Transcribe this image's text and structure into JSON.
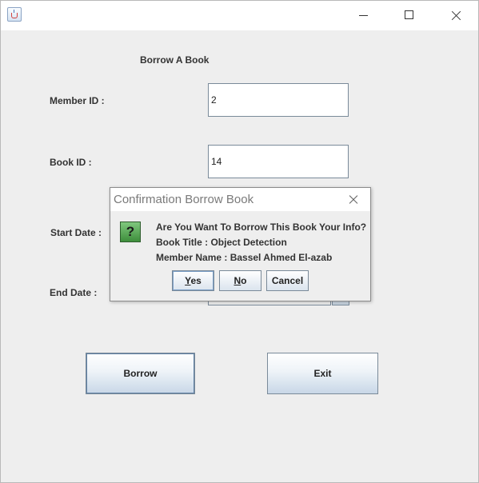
{
  "window": {
    "icon": "java-cup-icon",
    "controls": {
      "minimize": "minimize-icon",
      "maximize": "maximize-icon",
      "close": "close-icon"
    }
  },
  "form": {
    "heading": "Borrow A Book",
    "member_id_label": "Member ID :",
    "member_id_value": "2",
    "book_id_label": "Book ID :",
    "book_id_value": "14",
    "start_date_label": "Start Date :",
    "end_date_label": "End Date :",
    "borrow_label": "Borrow",
    "exit_label": "Exit"
  },
  "dialog": {
    "title": "Confirmation Borrow Book",
    "icon": "question-icon",
    "question_mark": "?",
    "message_line1": "Are You Want To Borrow This Book Your Info?",
    "message_line2": "Book Title : Object Detection",
    "message_line3": "Member Name : Bassel Ahmed El-azab",
    "buttons": {
      "yes_mnemonic": "Y",
      "yes_rest": "es",
      "no_mnemonic": "N",
      "no_rest": "o",
      "cancel": "Cancel"
    }
  }
}
